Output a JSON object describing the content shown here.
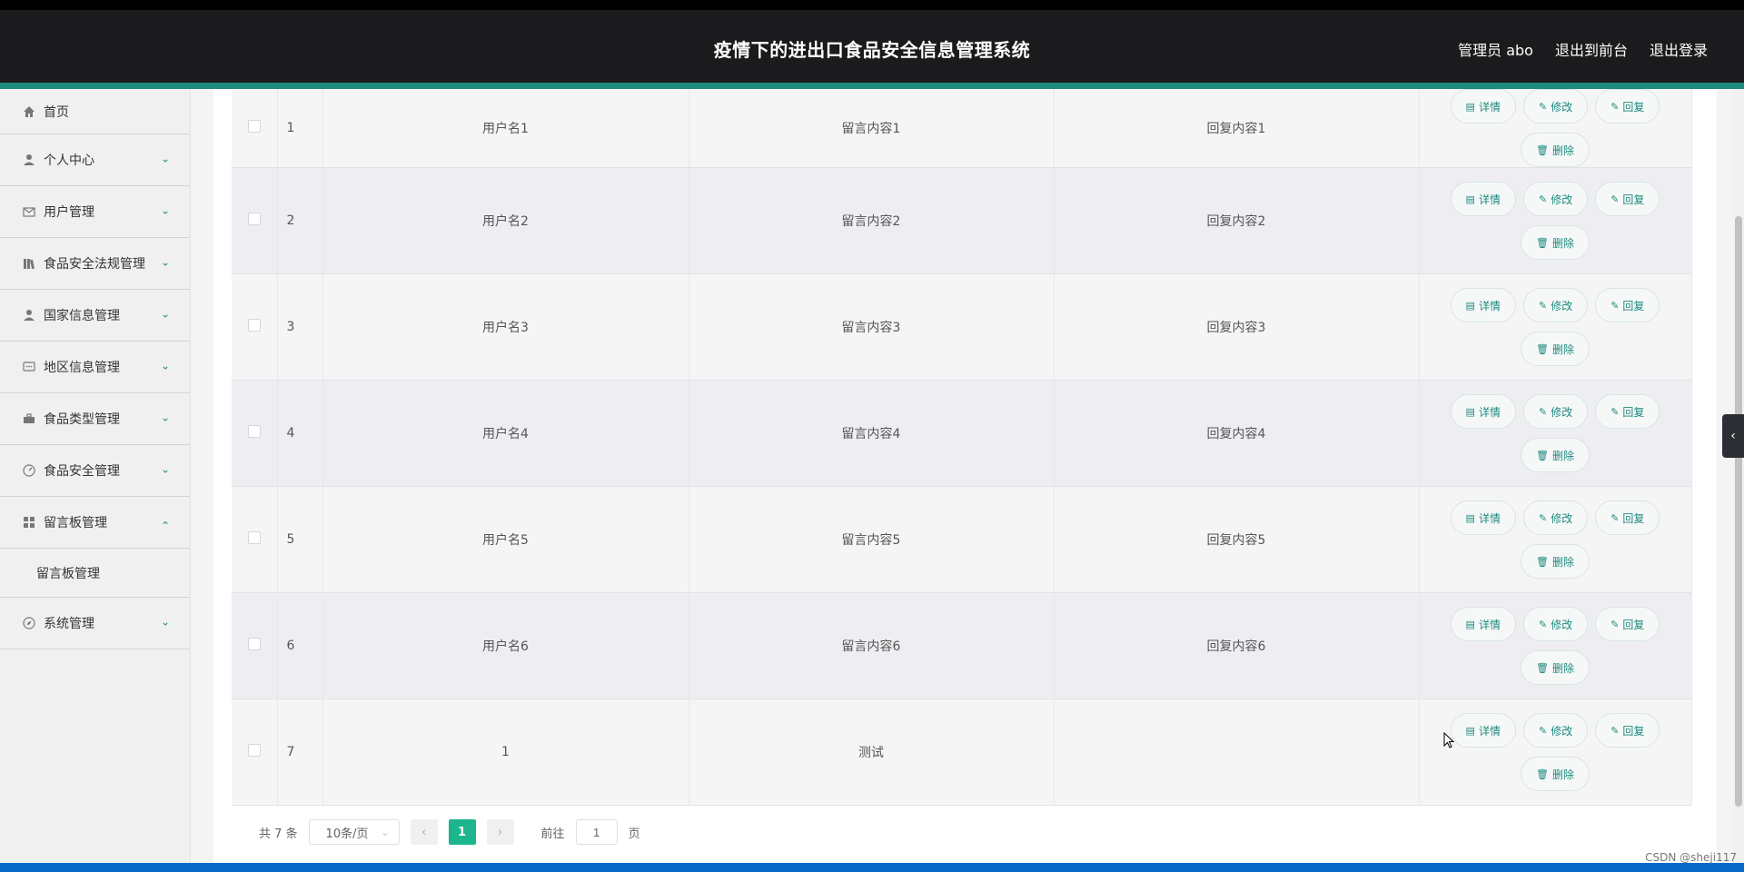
{
  "header": {
    "title": "疫情下的进出口食品安全信息管理系统",
    "user": "管理员 abo",
    "to_front": "退出到前台",
    "logout": "退出登录"
  },
  "sidebar": {
    "items": [
      {
        "label": "首页",
        "icon": "home-icon"
      },
      {
        "label": "个人中心",
        "icon": "user-icon"
      },
      {
        "label": "用户管理",
        "icon": "mail-icon"
      },
      {
        "label": "食品安全法规管理",
        "icon": "books-icon"
      },
      {
        "label": "国家信息管理",
        "icon": "user-icon"
      },
      {
        "label": "地区信息管理",
        "icon": "chat-icon"
      },
      {
        "label": "食品类型管理",
        "icon": "briefcase-icon"
      },
      {
        "label": "食品安全管理",
        "icon": "gauge-icon"
      },
      {
        "label": "留言板管理",
        "icon": "grid-icon"
      },
      {
        "label": "留言板管理",
        "icon": ""
      },
      {
        "label": "系统管理",
        "icon": "compass-icon"
      }
    ]
  },
  "table": {
    "rows": [
      {
        "index": "1",
        "username": "用户名1",
        "content": "留言内容1",
        "reply": "回复内容1"
      },
      {
        "index": "2",
        "username": "用户名2",
        "content": "留言内容2",
        "reply": "回复内容2"
      },
      {
        "index": "3",
        "username": "用户名3",
        "content": "留言内容3",
        "reply": "回复内容3"
      },
      {
        "index": "4",
        "username": "用户名4",
        "content": "留言内容4",
        "reply": "回复内容4"
      },
      {
        "index": "5",
        "username": "用户名5",
        "content": "留言内容5",
        "reply": "回复内容5"
      },
      {
        "index": "6",
        "username": "用户名6",
        "content": "留言内容6",
        "reply": "回复内容6"
      },
      {
        "index": "7",
        "username": "1",
        "content": "测试",
        "reply": ""
      }
    ],
    "actions": {
      "detail": "详情",
      "edit": "修改",
      "reply": "回复",
      "delete": "删除"
    }
  },
  "pagination": {
    "total": "共 7 条",
    "page_size": "10条/页",
    "current_page": "1",
    "goto_label": "前往",
    "goto_value": "1",
    "page_suffix": "页"
  },
  "watermark": "CSDN @sheji117",
  "colors": {
    "accent": "#1e8a7e",
    "header_bg": "#1b1b1d",
    "page_active": "#1db58e"
  }
}
